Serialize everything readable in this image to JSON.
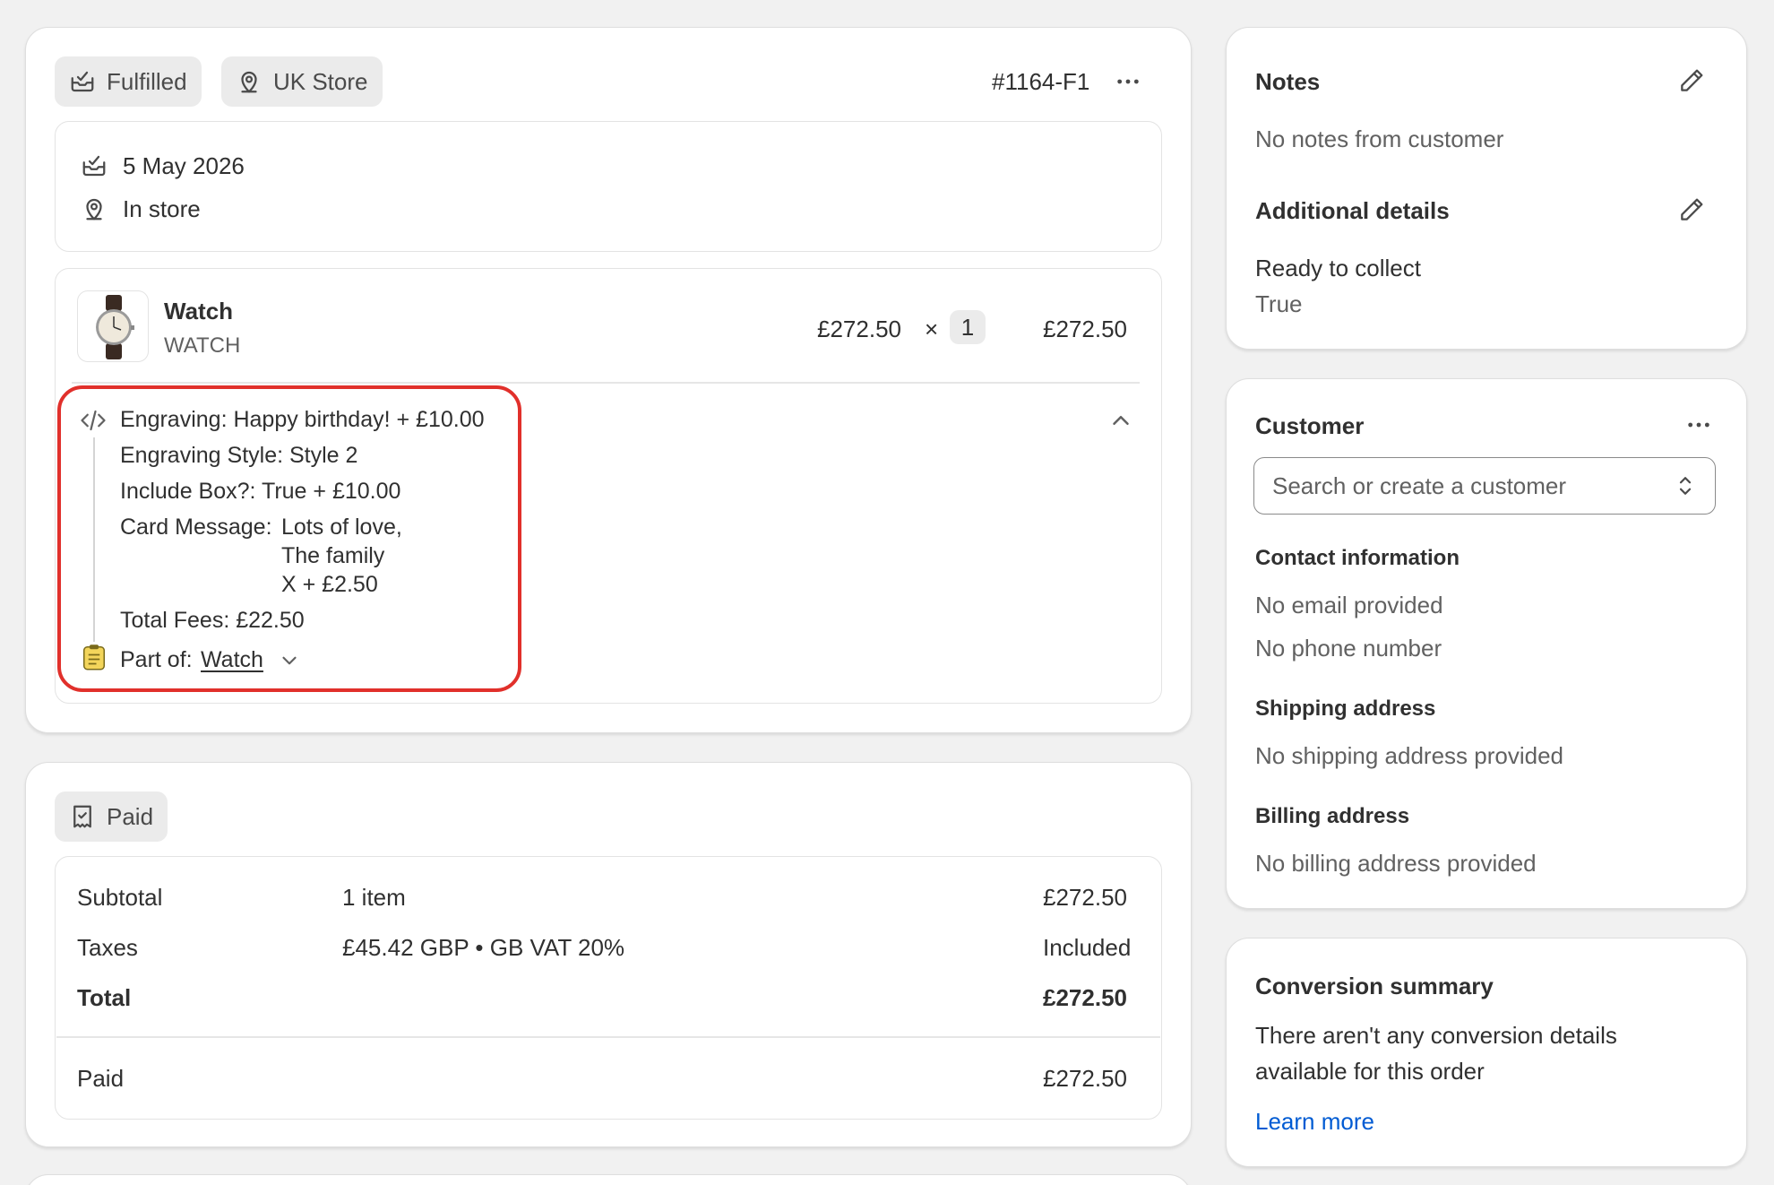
{
  "fulfillment": {
    "status_label": "Fulfilled",
    "location_label": "UK Store",
    "order_id": "#1164-F1",
    "date": "5 May 2026",
    "method": "In store",
    "item": {
      "name": "Watch",
      "sku": "WATCH",
      "unit_price": "£272.50",
      "times": "×",
      "quantity": "1",
      "line_total": "£272.50"
    },
    "properties": {
      "engraving": "Engraving: Happy birthday! + £10.00",
      "engraving_style": "Engraving Style: Style 2",
      "include_box": "Include Box?: True + £10.00",
      "card_message_label": "Card Message:",
      "card_message_lines": [
        "Lots of love,",
        "The family",
        "X + £2.50"
      ],
      "total_fees": "Total Fees: £22.50",
      "part_of_label": "Part of:",
      "part_of_link": "Watch"
    }
  },
  "payment": {
    "status_label": "Paid",
    "rows": {
      "subtotal": {
        "label": "Subtotal",
        "detail": "1 item",
        "amount": "£272.50"
      },
      "taxes": {
        "label": "Taxes",
        "detail": "£45.42 GBP • GB VAT 20%",
        "amount": "Included"
      },
      "total": {
        "label": "Total",
        "amount": "£272.50"
      },
      "paid": {
        "label": "Paid",
        "amount": "£272.50"
      }
    }
  },
  "notes": {
    "title": "Notes",
    "text": "No notes from customer",
    "additional_title": "Additional details",
    "detail_label": "Ready to collect",
    "detail_value": "True"
  },
  "customer": {
    "title": "Customer",
    "search_placeholder": "Search or create a customer",
    "contact_title": "Contact information",
    "email": "No email provided",
    "phone": "No phone number",
    "shipping_title": "Shipping address",
    "shipping_text": "No shipping address provided",
    "billing_title": "Billing address",
    "billing_text": "No billing address provided"
  },
  "conversion": {
    "title": "Conversion summary",
    "text_line1": "There aren't any conversion details",
    "text_line2": "available for this order",
    "link": "Learn more"
  },
  "icons": {
    "fulfilled": "fulfilled-box-icon",
    "location": "location-pin-icon",
    "more": "more-horizontal-icon",
    "code": "code-icon",
    "chevron_up": "chevron-up-icon",
    "chevron_down": "chevron-down-icon",
    "clipboard": "clipboard-icon",
    "receipt": "receipt-check-icon",
    "edit": "pencil-edit-icon",
    "select": "select-updown-icon"
  },
  "colors": {
    "accent_link": "#005bd3",
    "highlight": "#e1302b",
    "background": "#f1f1f1"
  }
}
